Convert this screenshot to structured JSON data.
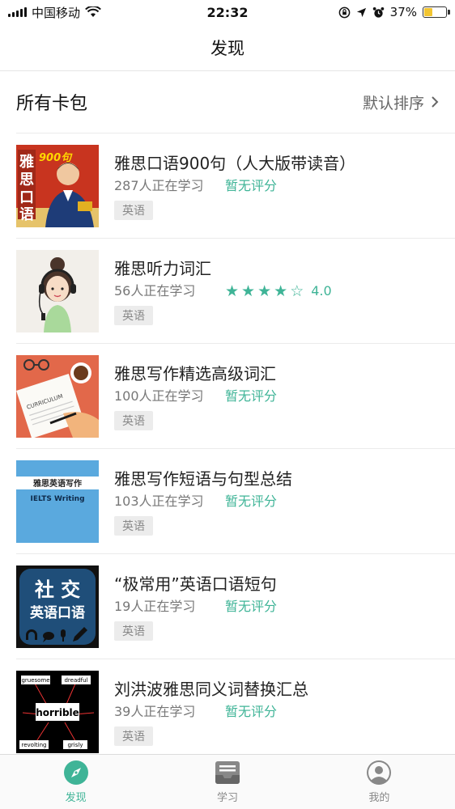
{
  "status_bar": {
    "carrier": "中国移动",
    "time": "22:32",
    "battery_percent": "37%",
    "battery_level": 0.37,
    "icons": [
      "signal-icon",
      "wifi-icon",
      "lock-rotation-icon",
      "location-icon",
      "alarm-icon",
      "battery-icon"
    ]
  },
  "nav": {
    "title": "发现"
  },
  "section": {
    "title": "所有卡包",
    "sort_label": "默认排序"
  },
  "items": [
    {
      "title": "雅思口语900句（人大版带读音）",
      "learners": "287人正在学习",
      "rating": "暂无评分",
      "tag": "英语",
      "thumb_color": "#c8341f"
    },
    {
      "title": "雅思听力词汇",
      "learners": "56人正在学习",
      "rating": "4.0",
      "stars": 4,
      "tag": "英语",
      "thumb_color": "#f2efea"
    },
    {
      "title": "雅思写作精选高级词汇",
      "learners": "100人正在学习",
      "rating": "暂无评分",
      "tag": "英语",
      "thumb_color": "#e2684a"
    },
    {
      "title": "雅思写作短语与句型总结",
      "learners": "103人正在学习",
      "rating": "暂无评分",
      "tag": "英语",
      "thumb_color": "#5aa9de",
      "thumb_text_1": "雅思英语写作",
      "thumb_text_2": "IELTS Writing"
    },
    {
      "title": "“极常用”英语口语短句",
      "learners": "19人正在学习",
      "rating": "暂无评分",
      "tag": "英语",
      "thumb_color": "#1f4e79",
      "thumb_text_1": "社 交",
      "thumb_text_2": "英语口语"
    },
    {
      "title": "刘洪波雅思同义词替换汇总",
      "learners": "39人正在学习",
      "rating": "暂无评分",
      "tag": "英语",
      "thumb_color": "#000000",
      "thumb_center": "horrible",
      "thumb_words": [
        "gruesome",
        "dreadful",
        "revolting",
        "grisly"
      ]
    }
  ],
  "tabs": [
    {
      "label": "发现",
      "icon": "compass-icon",
      "active": true
    },
    {
      "label": "学习",
      "icon": "inbox-icon",
      "active": false
    },
    {
      "label": "我的",
      "icon": "user-icon",
      "active": false
    }
  ],
  "colors": {
    "accent": "#3fb497",
    "tag_bg": "#ececec",
    "text_secondary": "#777777"
  }
}
